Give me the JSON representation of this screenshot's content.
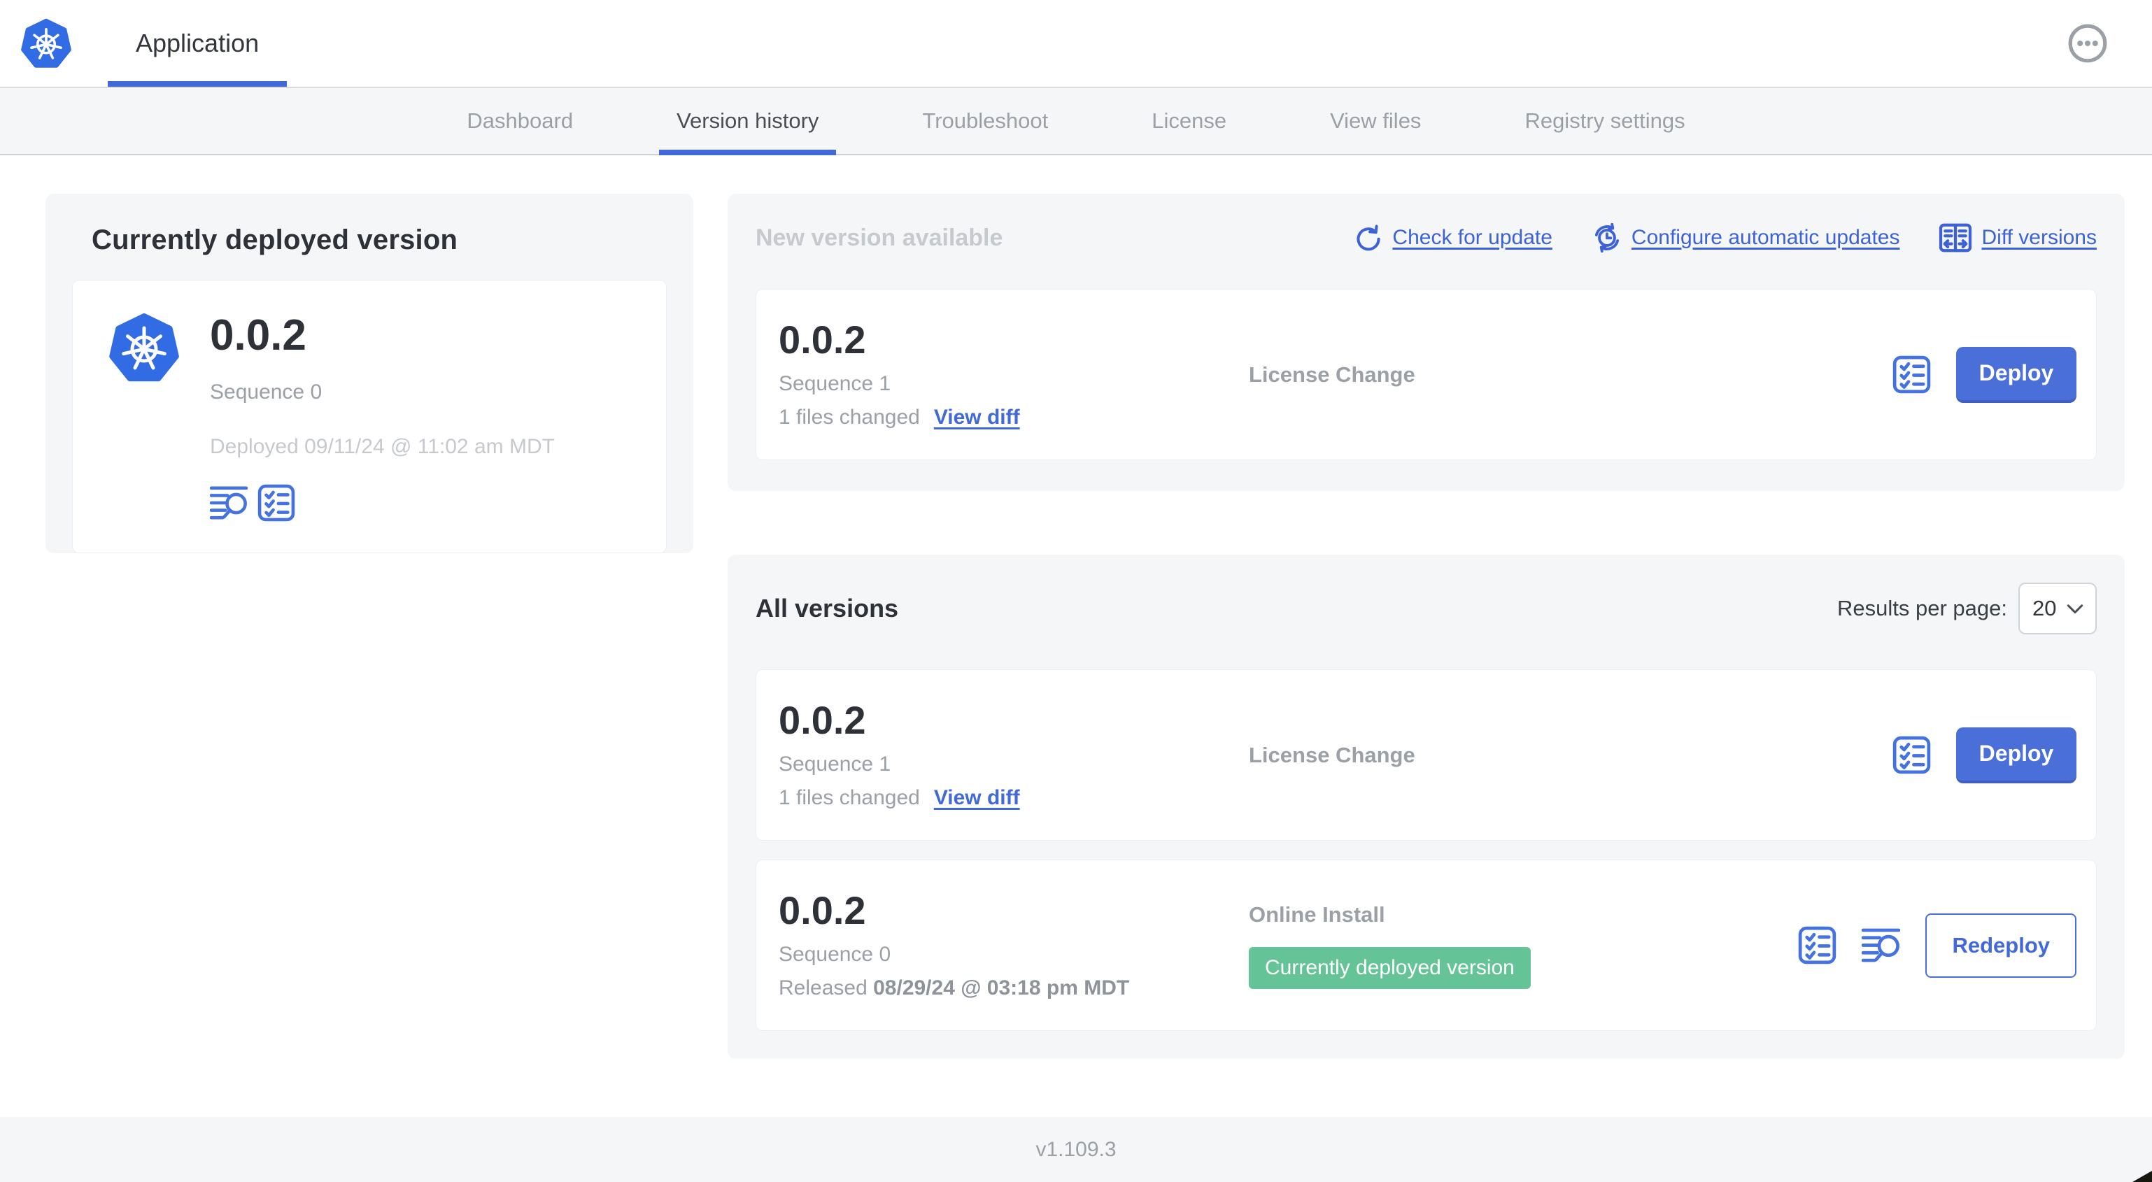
{
  "colors": {
    "accent_blue": "#4169d9",
    "button_blue": "#4a6fd8",
    "kubernetes_blue": "#326ce5",
    "badge_green": "#65c497",
    "nav_background": "#f5f6f8",
    "card_background": "#f5f6f8",
    "text_dark": "#2e3137",
    "text_gray": "#9ba0a7",
    "text_light_gray": "#c6c9ce"
  },
  "header": {
    "app_title": "Application",
    "logo_icon": "kubernetes-logo",
    "menu_icon": "ellipsis-circle-icon"
  },
  "nav": {
    "tabs": [
      {
        "label": "Dashboard",
        "active": false
      },
      {
        "label": "Version history",
        "active": true
      },
      {
        "label": "Troubleshoot",
        "active": false
      },
      {
        "label": "License",
        "active": false
      },
      {
        "label": "View files",
        "active": false
      },
      {
        "label": "Registry settings",
        "active": false
      }
    ]
  },
  "deployed_card": {
    "title": "Currently deployed version",
    "logo_icon": "kubernetes-logo",
    "version": "0.0.2",
    "sequence": "Sequence 0",
    "deployed_at": "Deployed 09/11/24 @ 11:02 am MDT",
    "icons": [
      "view-logs-icon",
      "preflight-checks-icon"
    ]
  },
  "new_version": {
    "title": "New version available",
    "actions": [
      {
        "label": "Check for update",
        "icon": "refresh-icon"
      },
      {
        "label": "Configure automatic updates",
        "icon": "auto-update-clock-icon"
      },
      {
        "label": "Diff versions",
        "icon": "diff-icon"
      }
    ],
    "row": {
      "version": "0.0.2",
      "sequence": "Sequence 1",
      "files_changed": "1 files changed",
      "view_diff_label": "View diff",
      "source": "License Change",
      "icons": [
        "preflight-checks-icon"
      ],
      "deploy_label": "Deploy"
    }
  },
  "all_versions": {
    "title": "All versions",
    "results_per_page_label": "Results per page:",
    "results_per_page_value": "20",
    "rows": [
      {
        "version": "0.0.2",
        "sequence": "Sequence 1",
        "files_changed": "1 files changed",
        "view_diff_label": "View diff",
        "source": "License Change",
        "icons": [
          "preflight-checks-icon"
        ],
        "action_label": "Deploy",
        "action_style": "primary"
      },
      {
        "version": "0.0.2",
        "sequence": "Sequence 0",
        "released_prefix": "Released",
        "released_date": "08/29/24 @ 03:18 pm MDT",
        "source": "Online Install",
        "badge": "Currently deployed version",
        "icons": [
          "preflight-checks-icon",
          "view-logs-icon"
        ],
        "action_label": "Redeploy",
        "action_style": "secondary"
      }
    ]
  },
  "footer": {
    "app_version": "v1.109.3"
  }
}
